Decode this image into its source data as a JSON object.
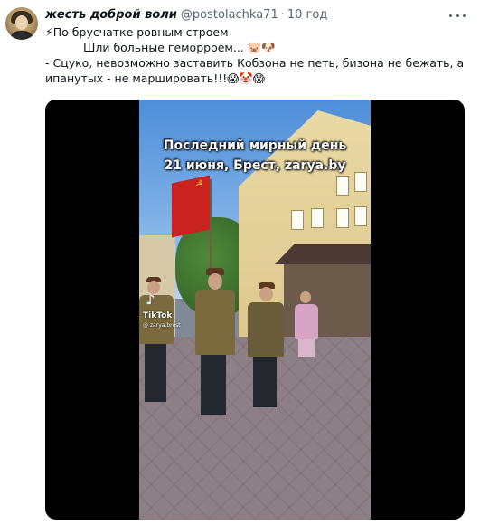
{
  "tweet": {
    "display_name": "жесть доброй воли",
    "handle": "@postolachka71",
    "separator": "·",
    "time": "10 год",
    "lines": [
      "⚡По брусчатке ровным строем",
      "Шли больные геморроем... 🐷🐶",
      " - Сцуко, невозможно заставить Кобзона не петь, бизона не бежать, а",
      "ипанутых - не маршировать!!!😱🤡😱"
    ]
  },
  "video": {
    "overlay_line1": "Последний мирный день",
    "overlay_line2": "21 июня, Брест, zarya.by",
    "watermark_brand": "TikTok",
    "watermark_user": "@ zarya.brest"
  },
  "icons": {
    "more": "more-horizontal-icon",
    "tiktok": "tiktok-logo-icon"
  },
  "colors": {
    "text_primary": "#0f1419",
    "text_secondary": "#536471",
    "media_background": "#000000",
    "flag_red": "#c8231e"
  }
}
